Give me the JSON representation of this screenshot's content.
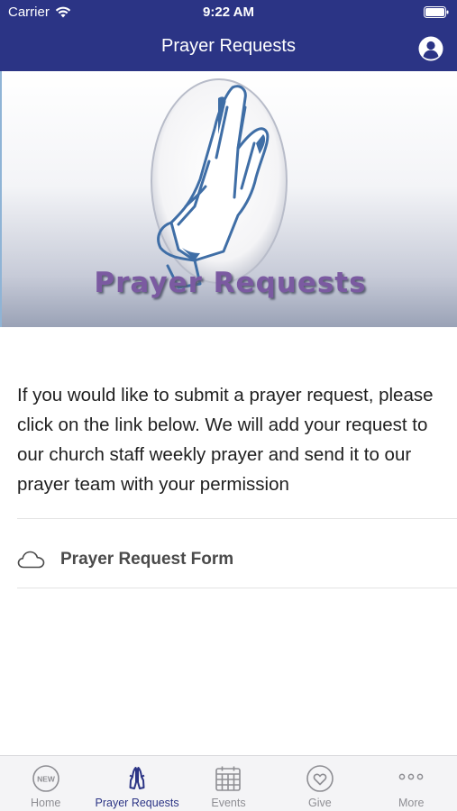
{
  "status_bar": {
    "carrier": "Carrier",
    "time": "9:22 AM"
  },
  "nav": {
    "title": "Prayer Requests",
    "profile_icon": "person-circle-icon"
  },
  "hero": {
    "image_caption": "Prayer Requests",
    "image_icon": "praying-hands-icon"
  },
  "content": {
    "description": "If you would like to submit a prayer request, please click on the link below. We will add your request to our church staff weekly prayer and send it to our prayer team with your permission",
    "link": {
      "label": "Prayer Request Form",
      "icon": "cloud-icon"
    }
  },
  "tab_bar": {
    "items": [
      {
        "label": "Home",
        "icon": "new-badge-icon",
        "active": false
      },
      {
        "label": "Prayer Requests",
        "icon": "praying-hands-icon",
        "active": true
      },
      {
        "label": "Events",
        "icon": "calendar-icon",
        "active": false
      },
      {
        "label": "Give",
        "icon": "heart-circle-icon",
        "active": false
      },
      {
        "label": "More",
        "icon": "more-dots-icon",
        "active": false
      }
    ]
  },
  "colors": {
    "nav_background": "#2b3485",
    "active_tab": "#2b3485",
    "inactive_tab": "#8e8e93",
    "hero_caption": "#7b5aa1"
  }
}
